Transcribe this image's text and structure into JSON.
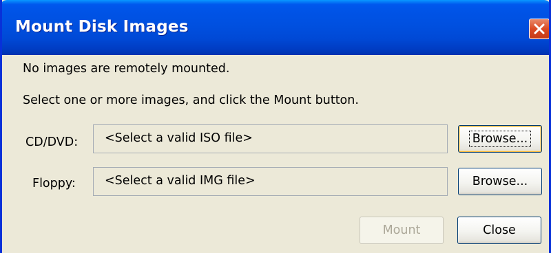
{
  "window": {
    "title": "Mount Disk Images"
  },
  "messages": {
    "status": "No images are remotely mounted.",
    "instruction": "Select one or more images, and click the Mount button."
  },
  "cd_dvd": {
    "label": "CD/DVD:",
    "placeholder": "<Select a valid ISO file>",
    "browse_label": "Browse..."
  },
  "floppy": {
    "label": "Floppy:",
    "placeholder": "<Select a valid IMG file>",
    "browse_label": "Browse..."
  },
  "buttons": {
    "mount_label": "Mount",
    "mount_enabled": false,
    "close_label": "Close"
  },
  "icons": {
    "close": "close-icon"
  },
  "colors": {
    "titlebar": "#0053e6",
    "frame": "#0831d9",
    "dialog_background": "#ece9d8",
    "close_button": "#db4b25",
    "disabled_text": "#aca899",
    "focus_highlight": "#f8b53a"
  }
}
